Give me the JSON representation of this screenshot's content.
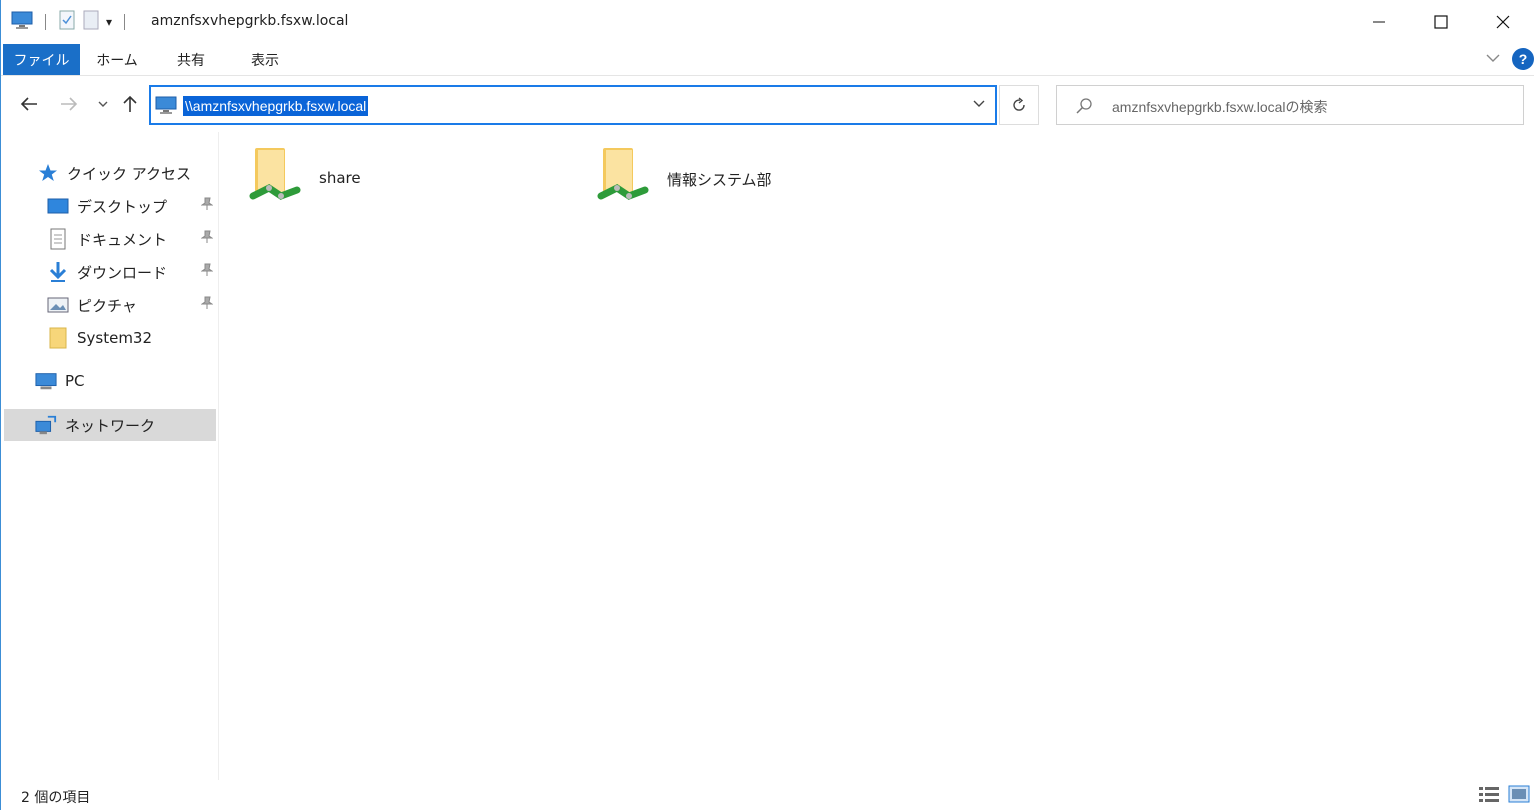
{
  "window": {
    "title": "amznfsxvhepgrkb.fsxw.local"
  },
  "ribbon": {
    "tabs": [
      "ファイル",
      "ホーム",
      "共有",
      "表示"
    ]
  },
  "address": {
    "path": "\\\\amznfsxvhepgrkb.fsxw.local",
    "search_placeholder": "amznfsxvhepgrkb.fsxw.localの検索"
  },
  "nav": {
    "quick_access": "クイック アクセス",
    "items": [
      {
        "label": "デスクトップ",
        "icon": "desktop-icon",
        "pinned": true
      },
      {
        "label": "ドキュメント",
        "icon": "documents-icon",
        "pinned": true
      },
      {
        "label": "ダウンロード",
        "icon": "download-icon",
        "pinned": true
      },
      {
        "label": "ピクチャ",
        "icon": "pictures-icon",
        "pinned": true
      },
      {
        "label": "System32",
        "icon": "folder-icon",
        "pinned": false
      }
    ],
    "pc": "PC",
    "network": "ネットワーク"
  },
  "content": {
    "items": [
      {
        "name": "share",
        "icon": "shared-folder-icon"
      },
      {
        "name": "情報システム部",
        "icon": "shared-folder-icon"
      }
    ]
  },
  "status": {
    "count_text": "2 個の項目"
  },
  "colors": {
    "accent": "#1a6fc8",
    "selection": "#0a64d8",
    "nav_selected": "#d9d9d9"
  }
}
